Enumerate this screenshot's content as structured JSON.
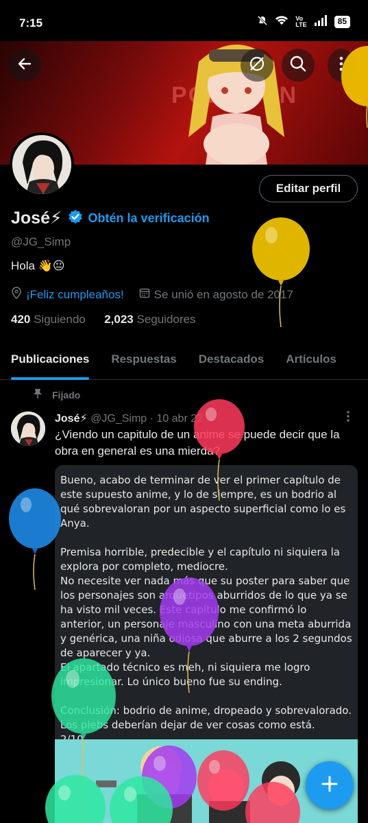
{
  "status_bar": {
    "time": "7:15",
    "battery": "85"
  },
  "header": {
    "back_icon": "arrow-left-icon",
    "grok_icon": "slash-circle-icon",
    "search_icon": "search-icon",
    "more_icon": "more-vertical-icon",
    "banner_text": "POKOFUN"
  },
  "profile": {
    "name": "José⚡",
    "verify_label": "Obtén la verificación",
    "handle": "@JG_Simp",
    "bio": "Hola 👋😐",
    "birthday": "¡Feliz cumpleaños!",
    "joined": "Se unió en agosto de 2017",
    "following_count": "420",
    "following_label": "Siguiendo",
    "followers_count": "2,023",
    "followers_label": "Seguidores",
    "edit_button": "Editar perfil"
  },
  "tabs": [
    {
      "label": "Publicaciones",
      "active": true
    },
    {
      "label": "Respuestas",
      "active": false
    },
    {
      "label": "Destacados",
      "active": false
    },
    {
      "label": "Artículos",
      "active": false
    }
  ],
  "post": {
    "pinned_label": "Fijado",
    "author": "José⚡",
    "handle_date": "@JG_Simp · 10 abr 22",
    "text": "¿Viendo un capitulo de un anime se puede decir que la obra en general es una mierda?",
    "card_text": "Bueno, acabo de terminar de ver el primer capítulo de este supuesto anime, y lo de siempre, es un bodrio al qué sobrevaloran por un aspecto superficial como lo es Anya.\n\nPremisa horrible, predecible y el capítulo ni siquiera la explora por completo, mediocre.\nNo necesite ver nada más que su poster para saber que los personajes son arquetipos aburridos de lo que ya se ha visto mil veces. Este capítulo me confirmó lo anterior, un personaje masculino con una meta aburrida y genérica, una niña odiosa que aburre a los 2 segundos de aparecer y ya.\nEl apartado técnico es meh, ni siquiera me logro impresionar. Lo único bueno fue su ending.\n\nConclusión: bodrio de anime, dropeado y sobrevalorado.\nLos plebs deberían dejar de ver cosas como está.\n2/10"
  },
  "fab": {
    "icon": "plus-icon"
  },
  "colors": {
    "accent": "#1d9bf0",
    "background": "#000000",
    "muted": "#71767b"
  }
}
